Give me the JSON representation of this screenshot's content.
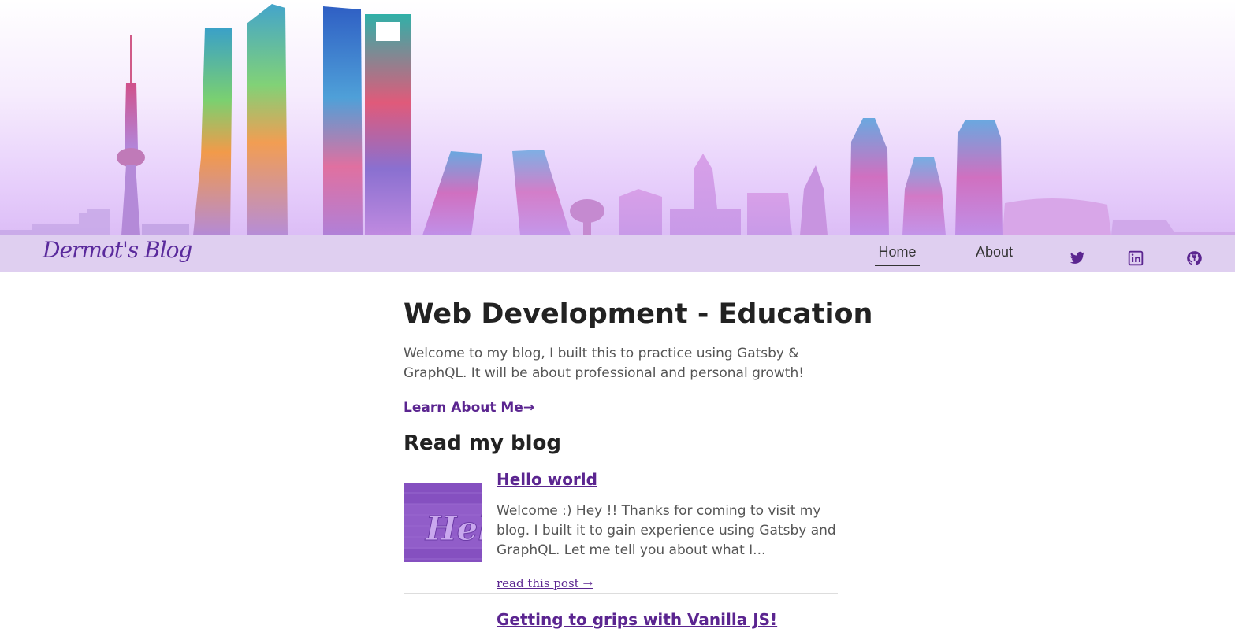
{
  "header": {
    "brand": "Dermot's Blog",
    "nav": [
      {
        "label": "Home",
        "active": true
      },
      {
        "label": "About",
        "active": false
      }
    ],
    "social": [
      {
        "icon": "twitter-icon"
      },
      {
        "icon": "linkedin-icon"
      },
      {
        "icon": "github-icon"
      }
    ],
    "accent_color": "#5b2590",
    "navbar_color": "#dfcff0"
  },
  "main": {
    "title": "Web Development - Education",
    "intro": "Welcome to my blog, I built this to practice using Gatsby & GraphQL. It will be about professional and personal growth!",
    "learn_link": "Learn About Me→",
    "section_title": "Read my blog",
    "posts": [
      {
        "title": "Hello world",
        "thumbnail_text": "Hello",
        "excerpt": "Welcome :) Hey !! Thanks for coming to visit my blog. I built it to gain experience using Gatsby and GraphQL. Let me tell you about what I...",
        "read_link": "read this post →"
      },
      {
        "title": "Getting to grips with Vanilla JS!"
      }
    ]
  }
}
